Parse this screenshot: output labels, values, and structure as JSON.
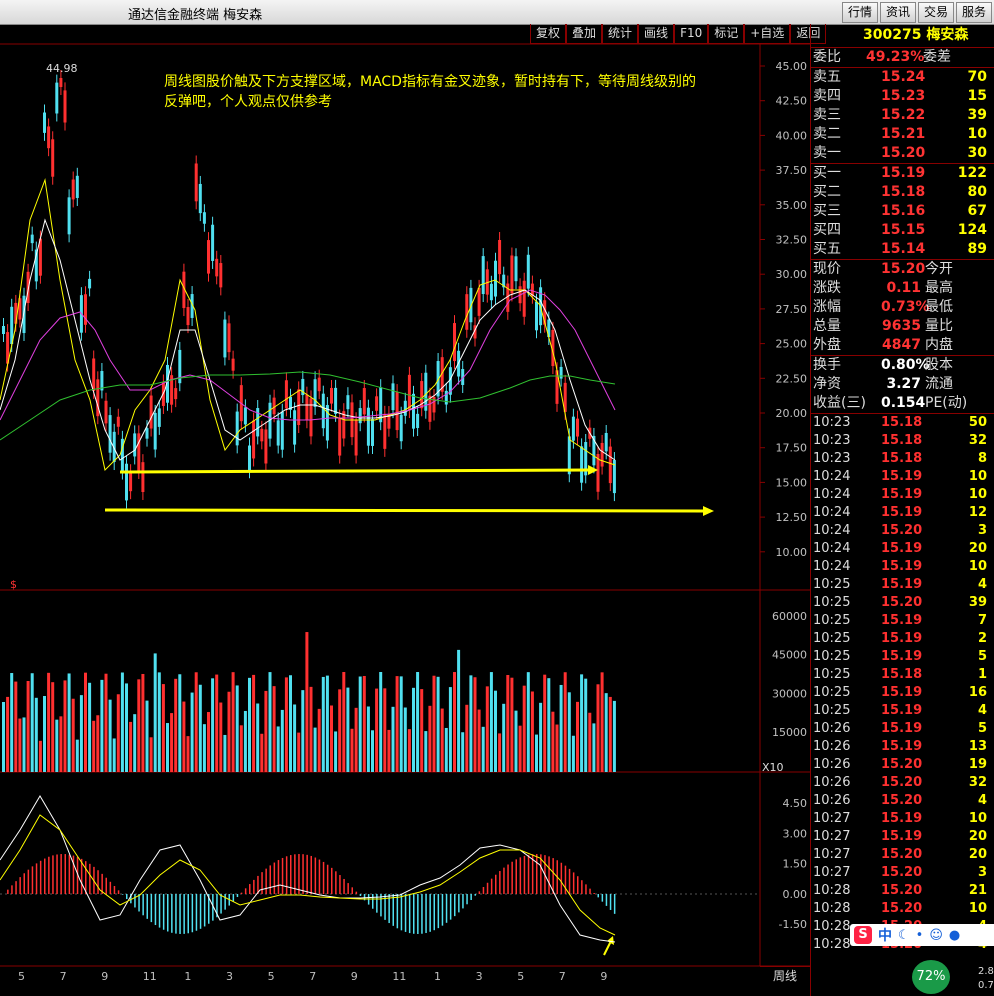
{
  "window": {
    "title": "通达信金融终端  梅安森"
  },
  "top_buttons": [
    "行情",
    "资讯",
    "交易",
    "服务"
  ],
  "toolbar": [
    "复权",
    "叠加",
    "统计",
    "画线",
    "F10",
    "标记",
    "+自选",
    "返回"
  ],
  "annotation": {
    "line1": "周线图股价触及下方支撑区域，MACD指标有金叉迹象，暂时持有下，等待周线级别的",
    "line2": "反弹吧，个人观点仅供参考",
    "high_label": "44.98",
    "s_label": "$"
  },
  "price_axis": [
    "45.00",
    "42.50",
    "40.00",
    "37.50",
    "35.00",
    "32.50",
    "30.00",
    "27.50",
    "25.00",
    "22.50",
    "20.00",
    "17.50",
    "15.00",
    "12.50",
    "10.00"
  ],
  "volume_axis": [
    "60000",
    "45000",
    "30000",
    "15000"
  ],
  "volume_unit": "X10",
  "macd_axis": [
    "4.50",
    "3.00",
    "1.50",
    "0.00",
    "-1.50"
  ],
  "month_labels": [
    "5",
    "7",
    "9",
    "11",
    "1",
    "3",
    "5",
    "7",
    "9",
    "11",
    "1",
    "3",
    "5",
    "7",
    "9"
  ],
  "period_label": "周线",
  "quote": {
    "code_name": "300275 梅安森",
    "weibi": {
      "label": "委比",
      "value": "49.23%",
      "label2": "委差"
    },
    "sell": [
      {
        "label": "卖五",
        "price": "15.24",
        "vol": "70"
      },
      {
        "label": "卖四",
        "price": "15.23",
        "vol": "15"
      },
      {
        "label": "卖三",
        "price": "15.22",
        "vol": "39"
      },
      {
        "label": "卖二",
        "price": "15.21",
        "vol": "10"
      },
      {
        "label": "卖一",
        "price": "15.20",
        "vol": "30"
      }
    ],
    "buy": [
      {
        "label": "买一",
        "price": "15.19",
        "vol": "122"
      },
      {
        "label": "买二",
        "price": "15.18",
        "vol": "80"
      },
      {
        "label": "买三",
        "price": "15.16",
        "vol": "67"
      },
      {
        "label": "买四",
        "price": "15.15",
        "vol": "124"
      },
      {
        "label": "买五",
        "price": "15.14",
        "vol": "89"
      }
    ],
    "stats": [
      {
        "l": "现价",
        "v": "15.20",
        "r": "今开"
      },
      {
        "l": "涨跌",
        "v": "0.11",
        "r": "最高"
      },
      {
        "l": "涨幅",
        "v": "0.73%",
        "r": "最低"
      },
      {
        "l": "总量",
        "v": "9635",
        "r": "量比"
      },
      {
        "l": "外盘",
        "v": "4847",
        "r": "内盘"
      }
    ],
    "stats2": [
      {
        "l": "换手",
        "v": "0.80%",
        "r": "股本"
      },
      {
        "l": "净资",
        "v": "3.27",
        "r": "流通"
      },
      {
        "l": "收益(三)",
        "v": "0.154",
        "r": "PE(动)"
      }
    ],
    "ticks": [
      [
        "10:23",
        "15.18",
        "50"
      ],
      [
        "10:23",
        "15.18",
        "32"
      ],
      [
        "10:23",
        "15.18",
        "8"
      ],
      [
        "10:24",
        "15.19",
        "10"
      ],
      [
        "10:24",
        "15.19",
        "10"
      ],
      [
        "10:24",
        "15.19",
        "12"
      ],
      [
        "10:24",
        "15.20",
        "3"
      ],
      [
        "10:24",
        "15.19",
        "20"
      ],
      [
        "10:24",
        "15.19",
        "10"
      ],
      [
        "10:25",
        "15.19",
        "4"
      ],
      [
        "10:25",
        "15.20",
        "39"
      ],
      [
        "10:25",
        "15.19",
        "7"
      ],
      [
        "10:25",
        "15.19",
        "2"
      ],
      [
        "10:25",
        "15.19",
        "5"
      ],
      [
        "10:25",
        "15.18",
        "1"
      ],
      [
        "10:25",
        "15.19",
        "16"
      ],
      [
        "10:25",
        "15.19",
        "4"
      ],
      [
        "10:26",
        "15.19",
        "5"
      ],
      [
        "10:26",
        "15.19",
        "13"
      ],
      [
        "10:26",
        "15.20",
        "19"
      ],
      [
        "10:26",
        "15.20",
        "32"
      ],
      [
        "10:26",
        "15.20",
        "4"
      ],
      [
        "10:27",
        "15.19",
        "10"
      ],
      [
        "10:27",
        "15.19",
        "20"
      ],
      [
        "10:27",
        "15.20",
        "20"
      ],
      [
        "10:27",
        "15.20",
        "3"
      ],
      [
        "10:28",
        "15.20",
        "21"
      ],
      [
        "10:28",
        "15.20",
        "10"
      ],
      [
        "10:28",
        "15.20",
        "4"
      ],
      [
        "10:28",
        "15.20",
        "4"
      ]
    ]
  },
  "ime": {
    "zh": "中",
    "percent": "72%",
    "r1": "2.8",
    "r2": "0.7"
  }
}
